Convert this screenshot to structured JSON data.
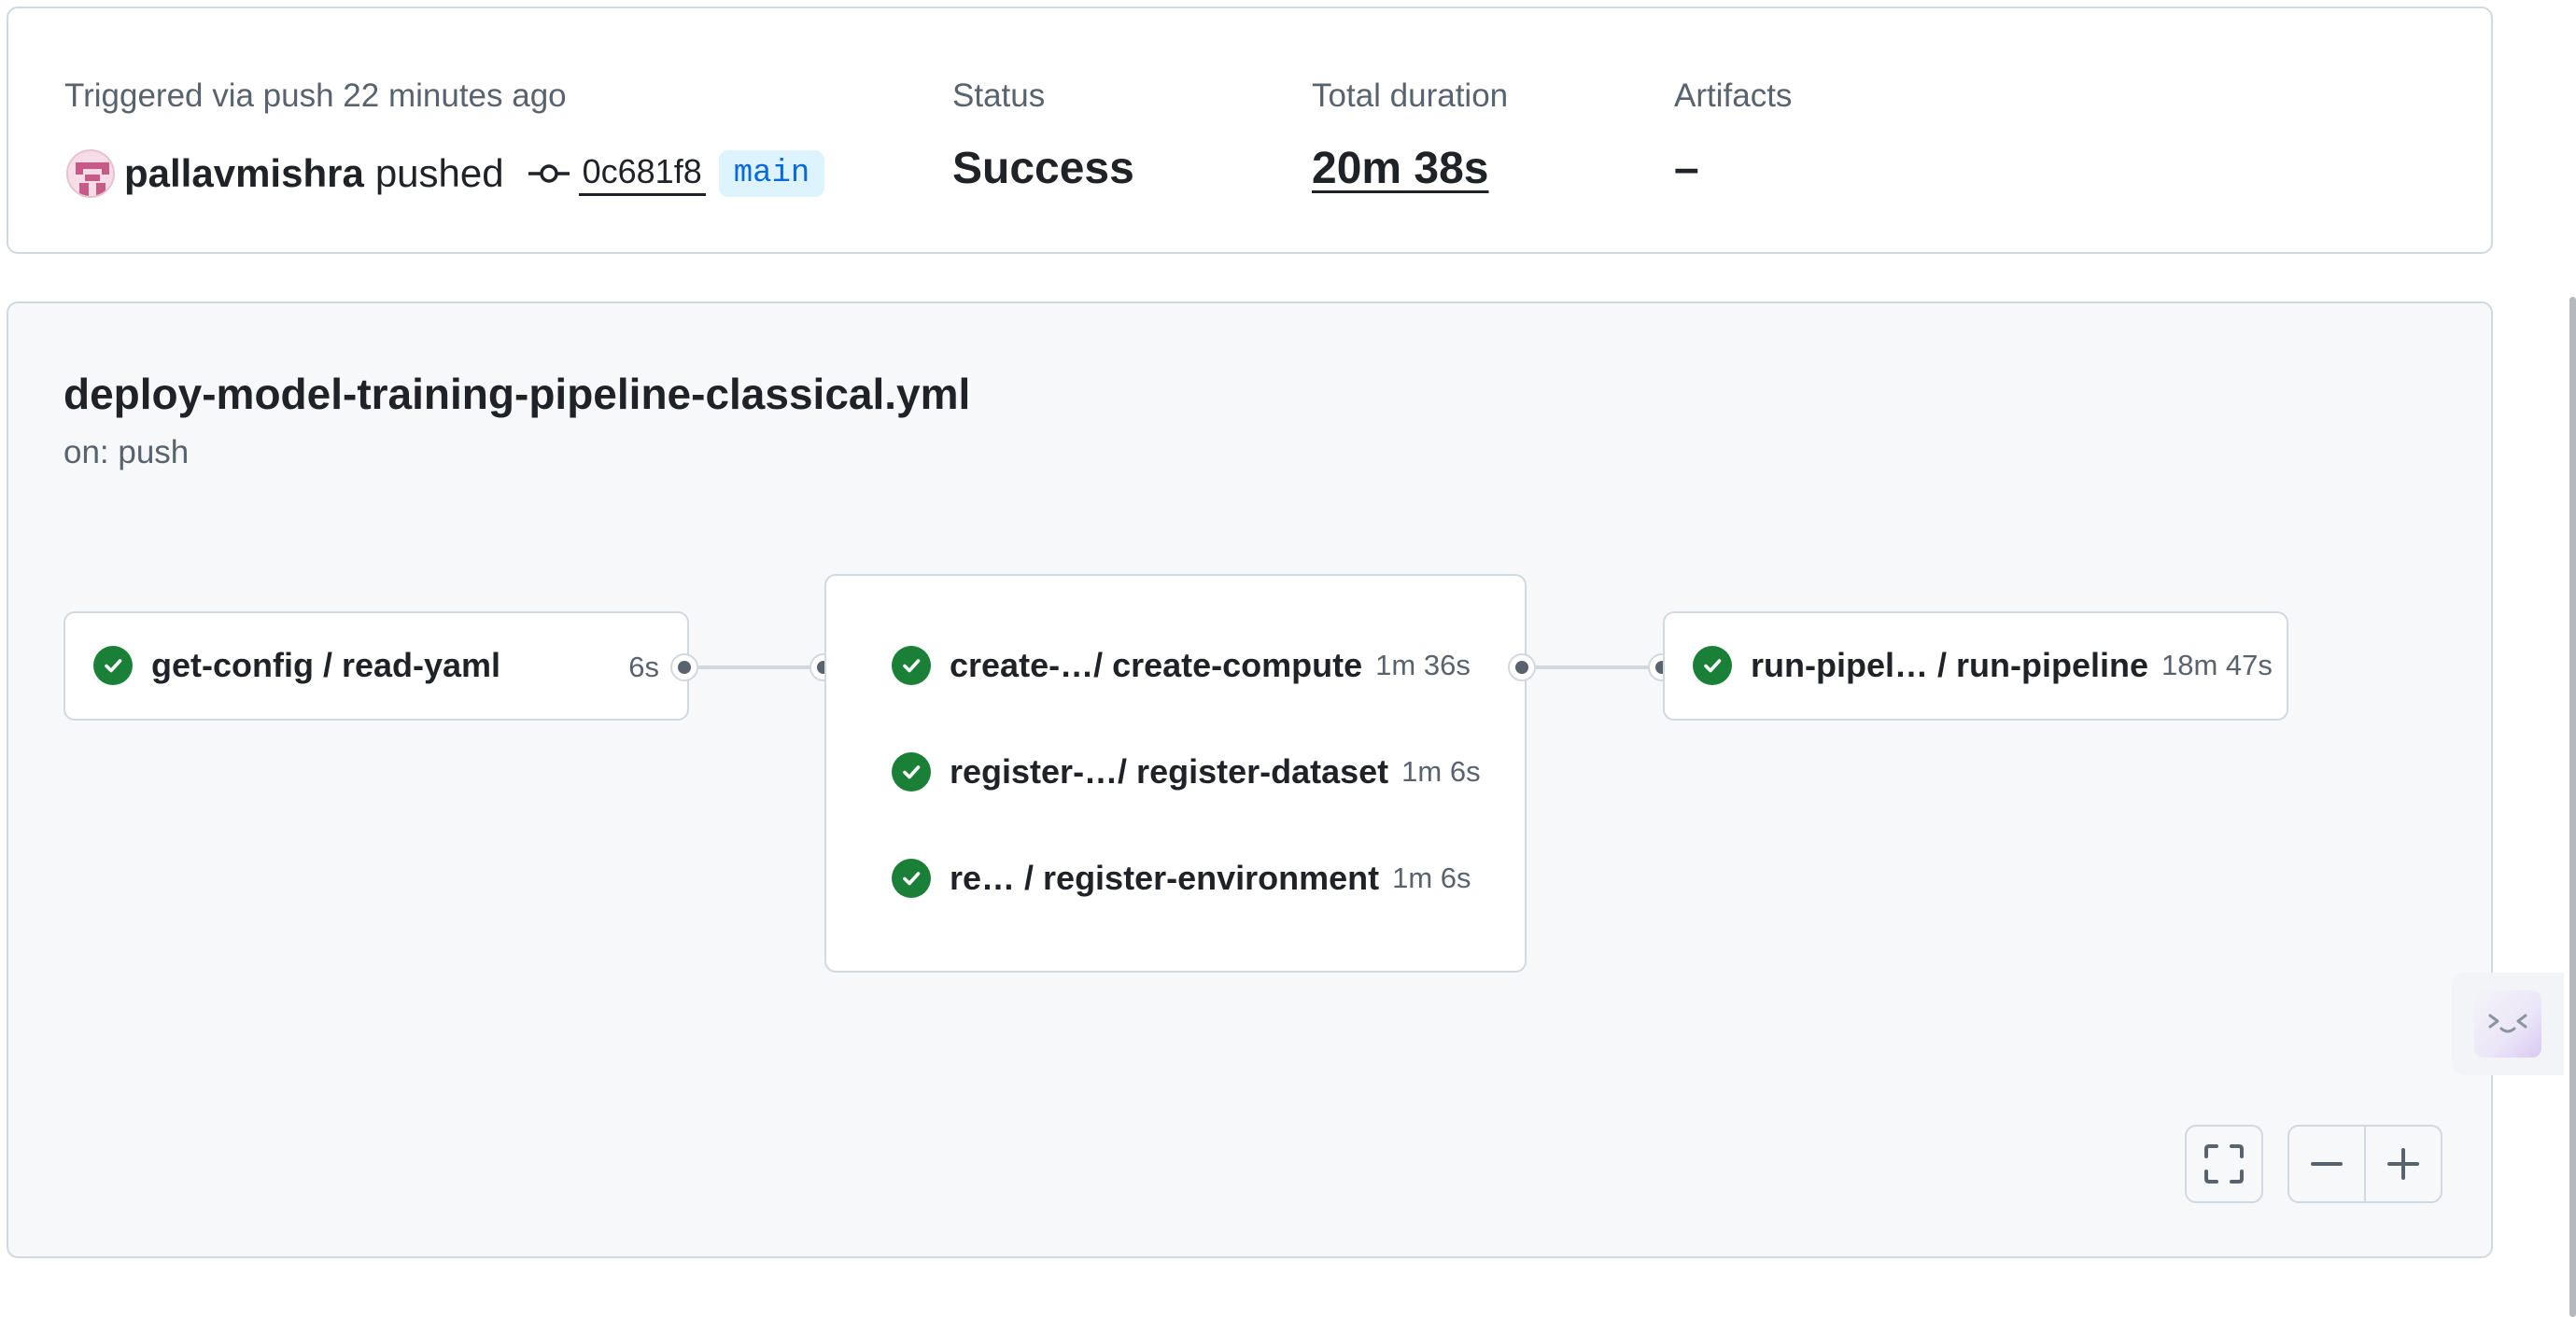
{
  "summary": {
    "trigger_label": "Triggered via push 22 minutes ago",
    "actor": "pallavmishra",
    "action": "pushed",
    "commit_sha": "0c681f8",
    "branch": "main",
    "status_label": "Status",
    "status_value": "Success",
    "duration_label": "Total duration",
    "duration_value": "20m 38s",
    "artifacts_label": "Artifacts",
    "artifacts_value": "–"
  },
  "workflow": {
    "file_name": "deploy-model-training-pipeline-classical.yml",
    "trigger": "on: push",
    "jobs": [
      {
        "name": "get-config / read-yaml",
        "duration": "6s",
        "status": "success"
      },
      {
        "name": "create-…/ create-compute",
        "duration": "1m 36s",
        "status": "success"
      },
      {
        "name": "register-…/ register-dataset",
        "duration": "1m 6s",
        "status": "success"
      },
      {
        "name": "re…  / register-environment",
        "duration": "1m 6s",
        "status": "success"
      },
      {
        "name": "run-pipel… / run-pipeline",
        "duration": "18m 47s",
        "status": "success"
      }
    ]
  },
  "controls": {
    "fullscreen": "fullscreen-icon",
    "zoom_out": "minus-icon",
    "zoom_in": "plus-icon"
  },
  "colors": {
    "success": "#1a7f37",
    "branch_text": "#0969da",
    "branch_bg": "#ddf4ff",
    "border": "#d1d9e0",
    "canvas_bg": "#f6f8fa"
  }
}
